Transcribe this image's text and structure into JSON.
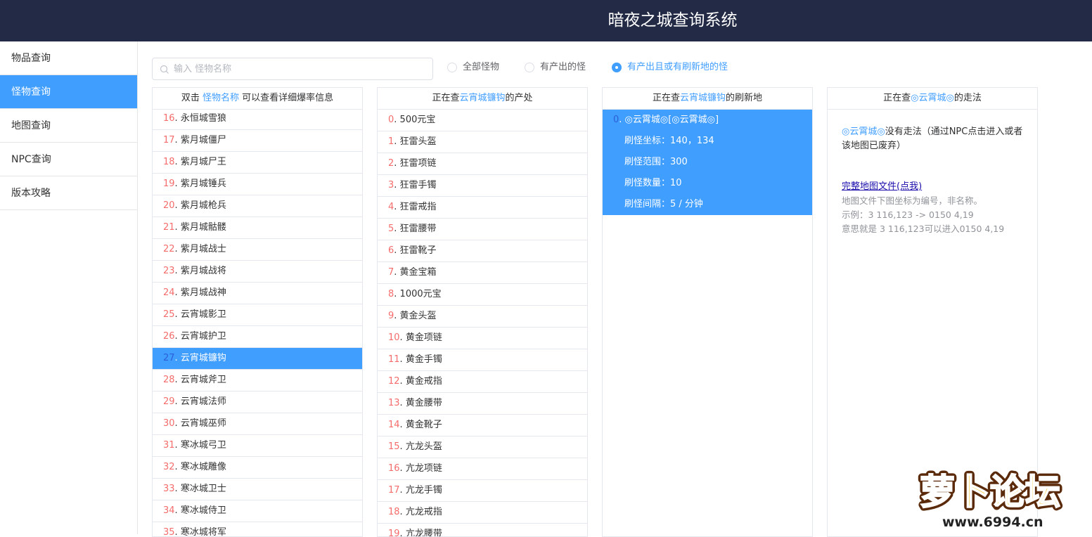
{
  "app": {
    "title": "暗夜之城查询系统"
  },
  "sidebar": {
    "items": [
      {
        "label": "物品查询",
        "active": false
      },
      {
        "label": "怪物查询",
        "active": true
      },
      {
        "label": "地图查询",
        "active": false
      },
      {
        "label": "NPC查询",
        "active": false
      },
      {
        "label": "版本攻略",
        "active": false
      }
    ]
  },
  "search": {
    "placeholder": "输入 怪物名称",
    "value": ""
  },
  "filters": {
    "options": [
      {
        "label": "全部怪物",
        "checked": false
      },
      {
        "label": "有产出的怪",
        "checked": false
      },
      {
        "label": "有产出且或有刷新地的怪",
        "checked": true
      }
    ]
  },
  "monsters": {
    "header": {
      "pre": "双击 ",
      "hl": "怪物名称",
      "post": " 可以查看详细爆率信息"
    },
    "selected_index": 11,
    "items": [
      {
        "num": "16",
        "name": "永恒城雪狼"
      },
      {
        "num": "17",
        "name": "紫月城僵尸"
      },
      {
        "num": "18",
        "name": "紫月城尸王"
      },
      {
        "num": "19",
        "name": "紫月城锤兵"
      },
      {
        "num": "20",
        "name": "紫月城枪兵"
      },
      {
        "num": "21",
        "name": "紫月城骷髅"
      },
      {
        "num": "22",
        "name": "紫月城战士"
      },
      {
        "num": "23",
        "name": "紫月城战将"
      },
      {
        "num": "24",
        "name": "紫月城战神"
      },
      {
        "num": "25",
        "name": "云宵城影卫"
      },
      {
        "num": "26",
        "name": "云宵城护卫"
      },
      {
        "num": "27",
        "name": "云宵城镰钩"
      },
      {
        "num": "28",
        "name": "云宵城斧卫"
      },
      {
        "num": "29",
        "name": "云宵城法师"
      },
      {
        "num": "30",
        "name": "云宵城巫师"
      },
      {
        "num": "31",
        "name": "寒冰城弓卫"
      },
      {
        "num": "32",
        "name": "寒冰城雕像"
      },
      {
        "num": "33",
        "name": "寒冰城卫士"
      },
      {
        "num": "34",
        "name": "寒冰城侍卫"
      },
      {
        "num": "35",
        "name": "寒冰城将军"
      }
    ]
  },
  "drops": {
    "header": {
      "pre": "正在查",
      "hl": "云宵城镰钩",
      "post": "的产处"
    },
    "items": [
      {
        "num": "0",
        "name": "500元宝"
      },
      {
        "num": "1",
        "name": "狂雷头盔"
      },
      {
        "num": "2",
        "name": "狂雷项链"
      },
      {
        "num": "3",
        "name": "狂雷手镯"
      },
      {
        "num": "4",
        "name": "狂雷戒指"
      },
      {
        "num": "5",
        "name": "狂雷腰带"
      },
      {
        "num": "6",
        "name": "狂雷靴子"
      },
      {
        "num": "7",
        "name": "黄金宝箱"
      },
      {
        "num": "8",
        "name": "1000元宝"
      },
      {
        "num": "9",
        "name": "黄金头盔"
      },
      {
        "num": "10",
        "name": "黄金项链"
      },
      {
        "num": "11",
        "name": "黄金手镯"
      },
      {
        "num": "12",
        "name": "黄金戒指"
      },
      {
        "num": "13",
        "name": "黄金腰带"
      },
      {
        "num": "14",
        "name": "黄金靴子"
      },
      {
        "num": "15",
        "name": "亢龙头盔"
      },
      {
        "num": "16",
        "name": "亢龙项链"
      },
      {
        "num": "17",
        "name": "亢龙手镯"
      },
      {
        "num": "18",
        "name": "亢龙戒指"
      },
      {
        "num": "19",
        "name": "亢龙腰带"
      }
    ]
  },
  "spawn": {
    "header": {
      "pre": "正在查",
      "hl": "云宵城镰钩",
      "post": "的刷新地"
    },
    "entry": {
      "num": "0",
      "title": "◎云霄城◎[◎云霄城◎]",
      "coords": "刷怪坐标：140，134",
      "range": "刷怪范围：300",
      "count": "刷怪数量：10",
      "interval": "刷怪间隔：5 / 分钟"
    }
  },
  "path": {
    "header": {
      "pre": "正在查",
      "hl": "◎云霄城◎",
      "post": "的走法"
    },
    "map_hl": "◎云霄城◎",
    "no_path_text": "没有走法（通过NPC点击进入或者该地图已废弃）",
    "link": "完整地图文件(点我)",
    "note1": "地图文件下图坐标为编号，非名称。",
    "note2": "示例：3 116,123 -> 0150 4,19",
    "note3": "意思就是 3 116,123可以进入0150 4,19"
  },
  "watermark": {
    "text": "萝卜论坛",
    "url": "www.6994.cn"
  },
  "colors": {
    "header_bg": "#222a45",
    "accent": "#409eff",
    "number": "#f56c6c"
  }
}
